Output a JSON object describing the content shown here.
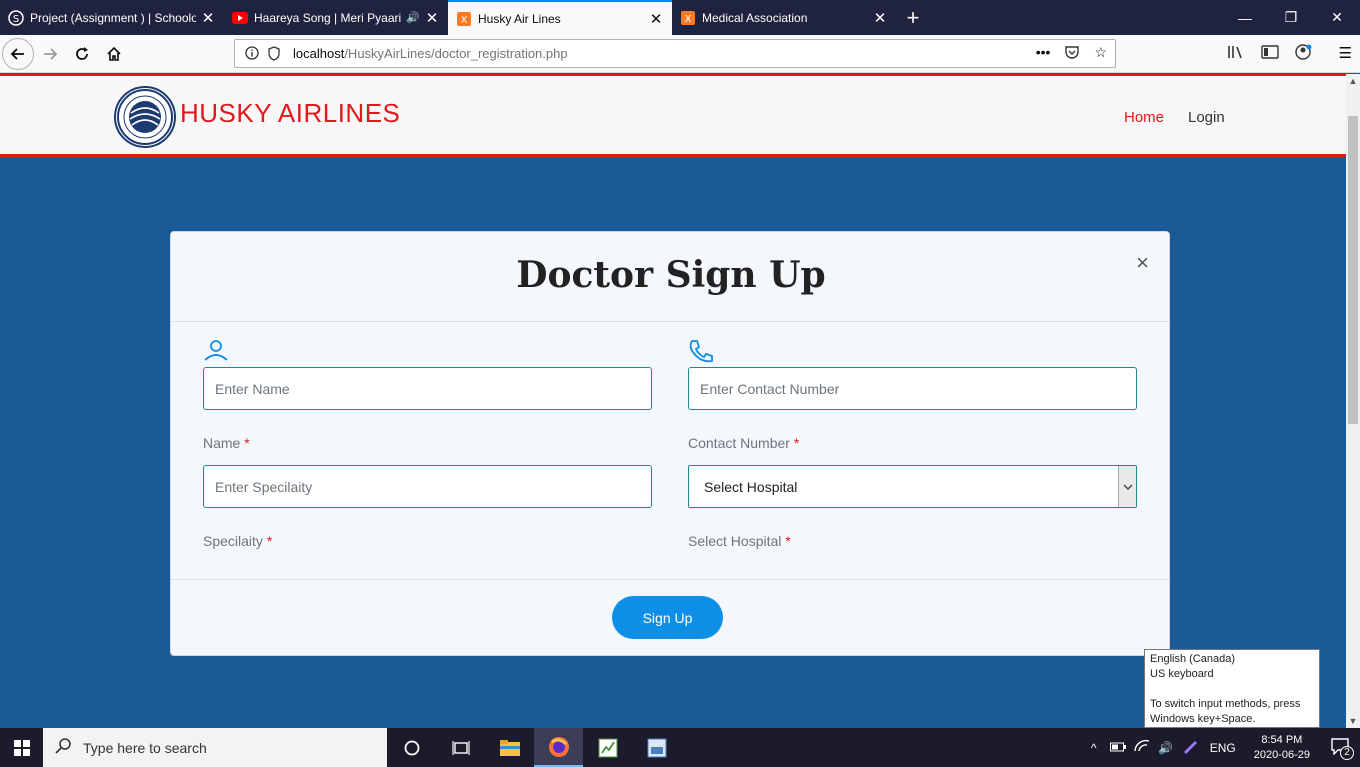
{
  "browser": {
    "tabs": [
      {
        "title": "Project (Assignment ) | Schoolo",
        "icon": "s-icon",
        "active": false
      },
      {
        "title": "Haareya Song | Meri Pyaari B",
        "icon": "youtube-icon",
        "active": false,
        "audio": true
      },
      {
        "title": "Husky Air Lines",
        "icon": "xampp-icon",
        "active": true
      },
      {
        "title": "Medical Association",
        "icon": "xampp-icon",
        "active": false
      }
    ],
    "url_host": "localhost",
    "url_path": "/HuskyAirLines/doctor_registration.php"
  },
  "site": {
    "brand": "HUSKY AIRLINES",
    "nav": {
      "home": "Home",
      "login": "Login"
    },
    "brand_color": "#e0191a"
  },
  "modal": {
    "title": "Doctor Sign Up",
    "close": "×",
    "fields": {
      "name": {
        "placeholder": "Enter Name",
        "label": "Name"
      },
      "contact": {
        "placeholder": "Enter Contact Number",
        "label": "Contact Number"
      },
      "specialty": {
        "placeholder": "Enter Specilaity",
        "label": "Specilaity"
      },
      "hospital": {
        "selected": "Select Hospital",
        "label": "Select Hospital"
      }
    },
    "required_mark": "*",
    "submit": "Sign Up"
  },
  "tooltip": {
    "line1": "English (Canada)",
    "line2": "US keyboard",
    "line3": "To switch input methods, press Windows key+Space."
  },
  "taskbar": {
    "search_placeholder": "Type here to search",
    "lang": "ENG",
    "time": "8:54 PM",
    "date": "2020-06-29",
    "notifications": "2"
  }
}
